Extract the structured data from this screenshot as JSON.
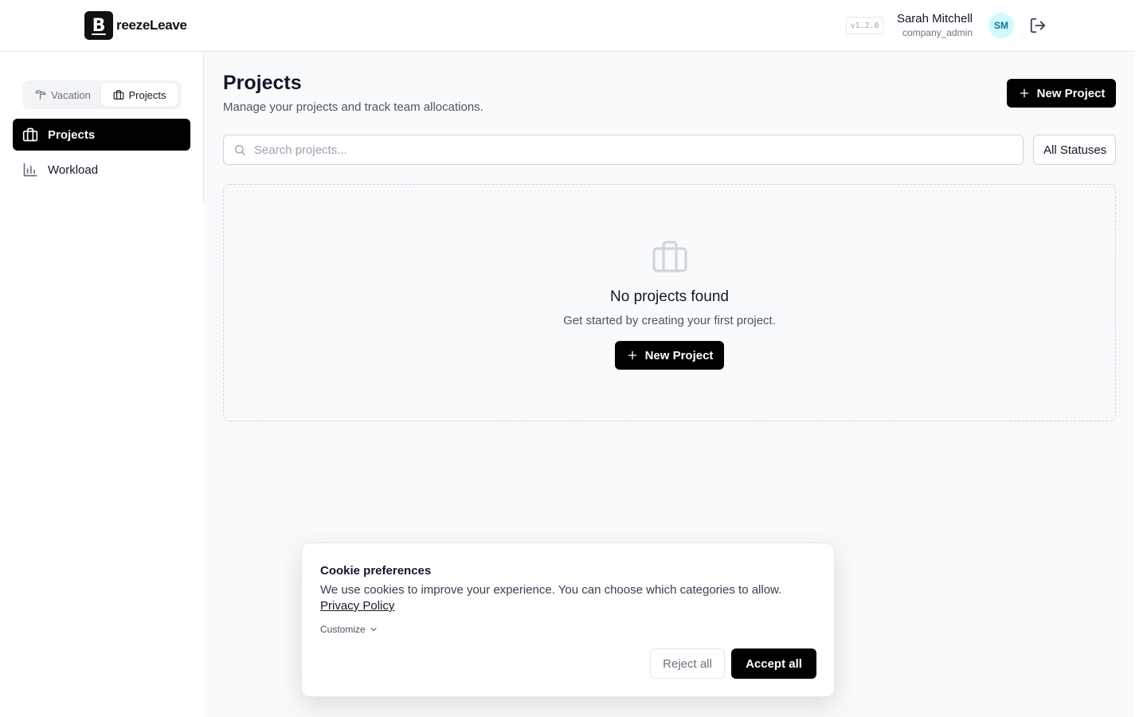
{
  "header": {
    "logo_letter": "B",
    "logo_text": "reezeLeave",
    "version": "v1.2.0",
    "user_name": "Sarah Mitchell",
    "user_role": "company_admin",
    "avatar_initials": "SM"
  },
  "sidebar": {
    "toggle": {
      "vacation": "Vacation",
      "projects": "Projects"
    },
    "items": [
      {
        "label": "Projects",
        "icon": "briefcase-icon",
        "active": true
      },
      {
        "label": "Workload",
        "icon": "bar-chart-icon",
        "active": false
      }
    ]
  },
  "main": {
    "title": "Projects",
    "subtitle": "Manage your projects and track team allocations.",
    "new_project_label": "New Project",
    "search_placeholder": "Search projects...",
    "status_filter": "All Statuses",
    "empty": {
      "title": "No projects found",
      "subtitle": "Get started by creating your first project.",
      "button": "New Project"
    }
  },
  "cookie": {
    "title": "Cookie preferences",
    "text": "We use cookies to improve your experience. You can choose which categories to allow.",
    "link": "Privacy Policy",
    "customize": "Customize",
    "reject": "Reject all",
    "accept": "Accept all"
  },
  "colors": {
    "primary": "#000000",
    "avatar_bg": "#cffafe",
    "avatar_text": "#0e7490",
    "background": "#f9fafb"
  }
}
